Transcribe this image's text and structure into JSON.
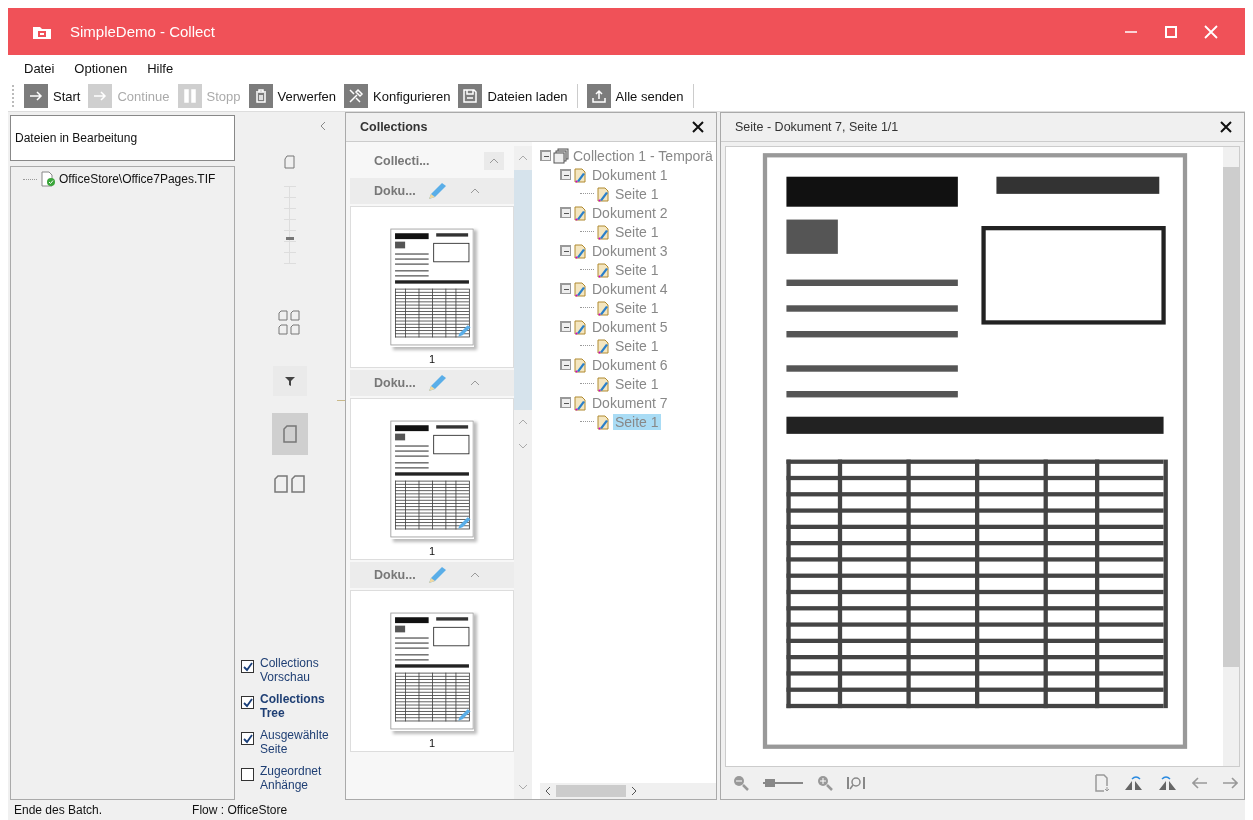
{
  "window": {
    "title": "SimpleDemo - Collect"
  },
  "menu": [
    "Datei",
    "Optionen",
    "Hilfe"
  ],
  "toolbar": [
    {
      "kind": "start",
      "label": "Start",
      "disabled": false
    },
    {
      "kind": "continue",
      "label": "Continue",
      "disabled": true
    },
    {
      "kind": "stop",
      "label": "Stopp",
      "disabled": true
    },
    {
      "kind": "discard",
      "label": "Verwerfen",
      "disabled": false
    },
    {
      "kind": "configure",
      "label": "Konfigurieren",
      "disabled": false
    },
    {
      "kind": "load",
      "label": "Dateien laden",
      "disabled": false
    },
    {
      "kind": "send",
      "label": "Alle senden",
      "disabled": false
    }
  ],
  "files_panel": {
    "title": "Dateien in Bearbeitung",
    "items": [
      {
        "label": "OfficeStore\\Office7Pages.TIF"
      }
    ]
  },
  "view_panel": {
    "zoom": {
      "level": 0.35
    },
    "layout_modes": [
      {
        "kind": "single",
        "selected": true
      },
      {
        "kind": "double",
        "selected": false
      }
    ],
    "options": [
      {
        "label": "Collections Vorschau",
        "checked": true,
        "selected": false
      },
      {
        "label": "Collections Tree",
        "checked": true,
        "selected": true
      },
      {
        "label": "Ausgewählte Seite",
        "checked": true,
        "selected": false
      },
      {
        "label": "Zugeordnet Anhänge",
        "checked": false,
        "selected": false
      }
    ]
  },
  "collections": {
    "title": "Collections",
    "header": "Collecti...",
    "documents": [
      {
        "label": "Doku...",
        "page_number": "1"
      },
      {
        "label": "Doku...",
        "page_number": "1"
      },
      {
        "label": "Doku...",
        "page_number": "1"
      }
    ]
  },
  "tree": {
    "label": "Collection 1 - Temporä",
    "selected": false,
    "children": [
      {
        "label": "Dokument 1",
        "selected": false,
        "children": [
          {
            "label": "Seite 1",
            "selected": false
          }
        ]
      },
      {
        "label": "Dokument 2",
        "selected": false,
        "children": [
          {
            "label": "Seite 1",
            "selected": false
          }
        ]
      },
      {
        "label": "Dokument 3",
        "selected": false,
        "children": [
          {
            "label": "Seite 1",
            "selected": false
          }
        ]
      },
      {
        "label": "Dokument 4",
        "selected": false,
        "children": [
          {
            "label": "Seite 1",
            "selected": false
          }
        ]
      },
      {
        "label": "Dokument 5",
        "selected": false,
        "children": [
          {
            "label": "Seite 1",
            "selected": false
          }
        ]
      },
      {
        "label": "Dokument 6",
        "selected": false,
        "children": [
          {
            "label": "Seite 1",
            "selected": false
          }
        ]
      },
      {
        "label": "Dokument 7",
        "selected": false,
        "children": [
          {
            "label": "Seite 1",
            "selected": true
          }
        ]
      }
    ]
  },
  "viewer": {
    "title": "Seite - Dokument 7, Seite 1/1",
    "zoom": {
      "level": 0.05
    }
  },
  "status_bar": [
    "Ende des Batch.",
    "Flow : OfficeStore"
  ]
}
